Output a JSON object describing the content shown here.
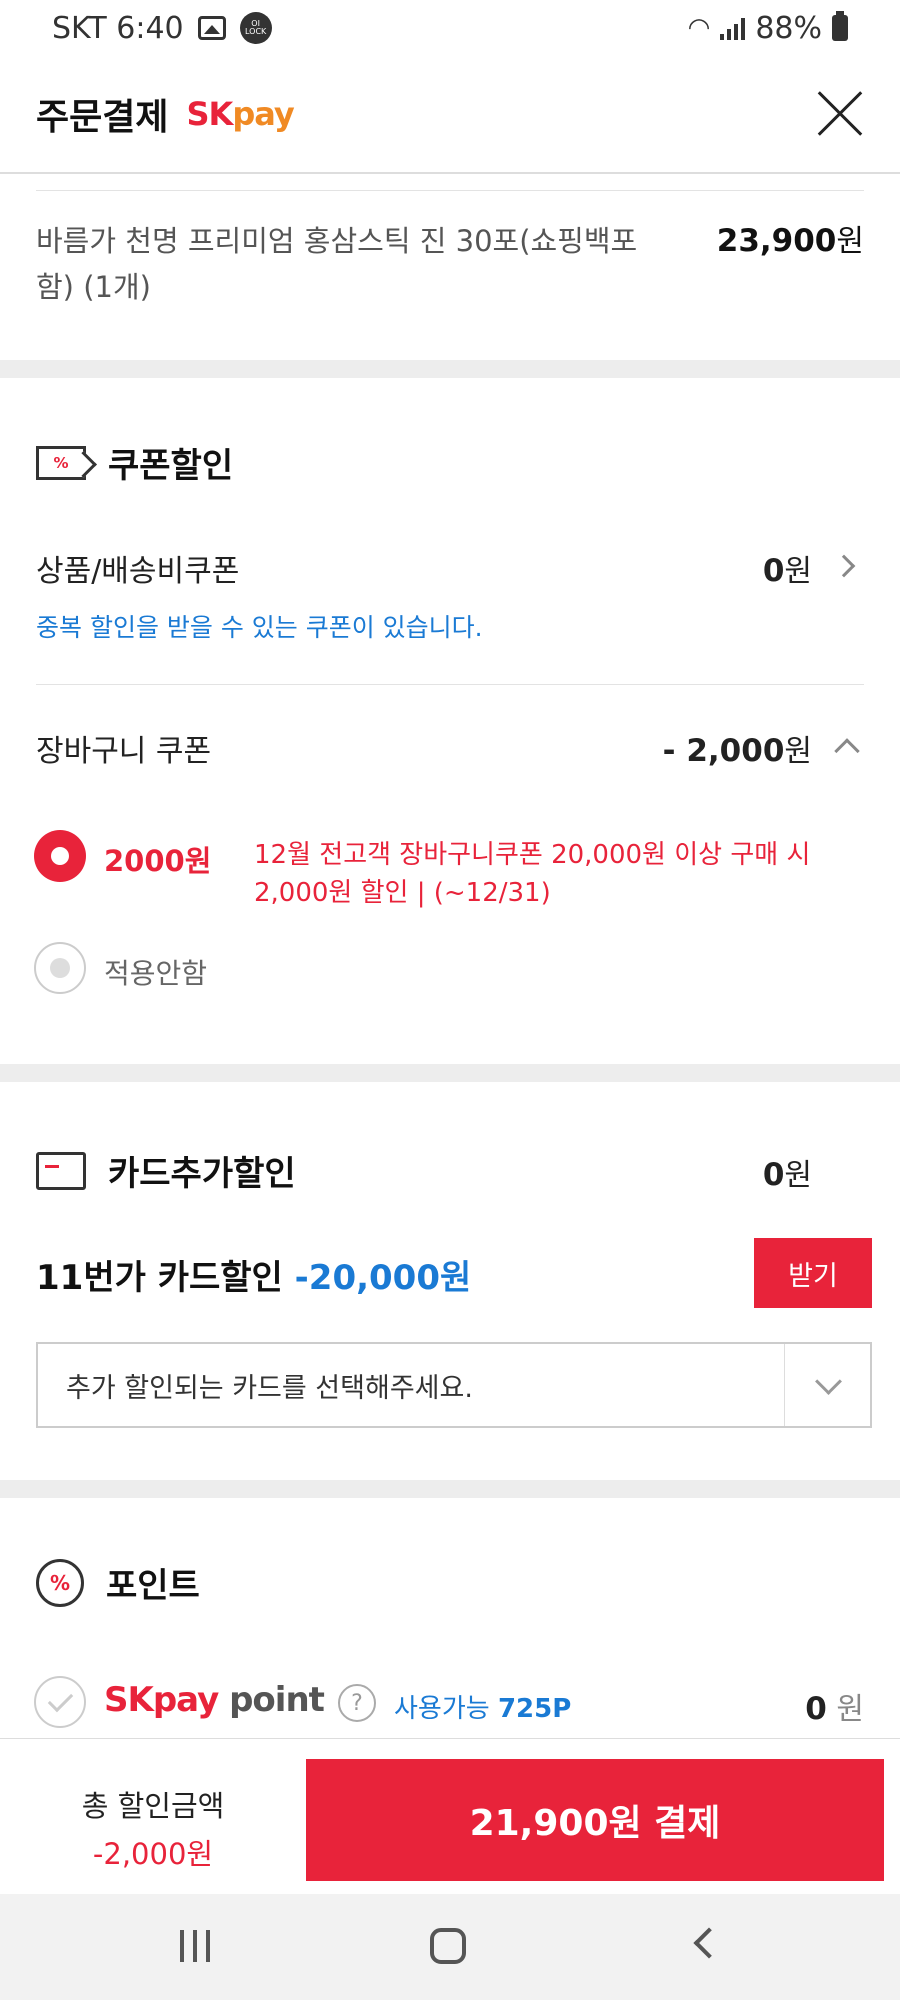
{
  "status_bar": {
    "carrier_time": "SKT 6:40",
    "lock_badge": "OI LOCK",
    "battery": "88%"
  },
  "header": {
    "title": "주문결제",
    "logo_sk": "SK",
    "logo_pay": "pay"
  },
  "product": {
    "name": "바름가 천명 프리미엄 홍삼스틱 진 30포(쇼핑백포함) (1개)",
    "price": "23,900",
    "currency": "원"
  },
  "coupon_section": {
    "title": "쿠폰할인",
    "product_shipping": {
      "label": "상품/배송비쿠폰",
      "amount": "0",
      "currency": "원",
      "info": "중복 할인을 받을 수 있는 쿠폰이 있습니다."
    },
    "cart": {
      "label": "장바구니 쿠폰",
      "amount": "- 2,000",
      "currency": "원"
    },
    "options": [
      {
        "amount": "2000원",
        "desc": "12월 전고객 장바구니쿠폰 20,000원 이상 구매 시 2,000원 할인 | (~12/31)",
        "selected": true
      },
      {
        "label": "적용안함",
        "selected": false
      }
    ]
  },
  "card_section": {
    "title": "카드추가할인",
    "amount": "0",
    "currency": "원",
    "promo_prefix": "11번가 카드할인 ",
    "promo_amount": "-20,000원",
    "receive_label": "받기",
    "select_placeholder": "추가 할인되는 카드를 선택해주세요."
  },
  "point_section": {
    "title": "포인트",
    "logo_sk": "SK",
    "logo_pay": "pay",
    "logo_point": " point",
    "help": "?",
    "available_label": "사용가능 ",
    "available_value": "725P",
    "amount": "0",
    "currency": "원"
  },
  "pay_bar": {
    "total_label": "총 할인금액",
    "total_value": "-2,000",
    "total_currency": "원",
    "pay_label": "21,900원 결제"
  },
  "colors": {
    "accent": "#e8233a",
    "link": "#1a7ad4",
    "pay_orange": "#f08a24"
  }
}
